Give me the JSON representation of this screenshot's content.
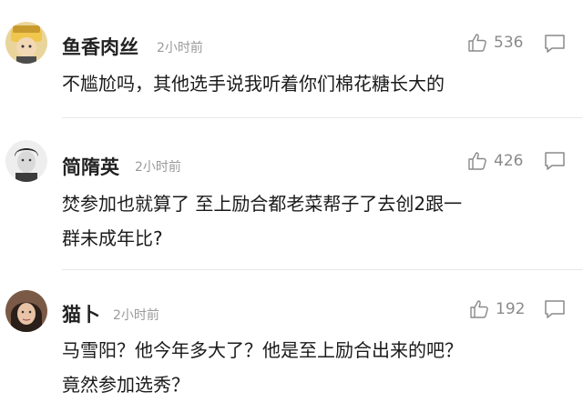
{
  "comments": [
    {
      "user": "鱼香肉丝",
      "time": "2小时前",
      "likes": "536",
      "lines": [
        "不尴尬吗，其他选手说我听着你们棉花糖长大的"
      ]
    },
    {
      "user": "简隋英",
      "time": "2小时前",
      "likes": "426",
      "lines": [
        "焚参加也就算了 至上励合都老菜帮子了去创2跟一",
        "群未成年比?"
      ]
    },
    {
      "user": "猫卜",
      "time": "2小时前",
      "likes": "192",
      "lines": [
        "马雪阳？他今年多大了？他是至上励合出来的吧？",
        "竟然参加选秀？"
      ]
    }
  ],
  "icons": {
    "like": "thumbs-up-icon",
    "reply": "comment-bubble-icon"
  }
}
